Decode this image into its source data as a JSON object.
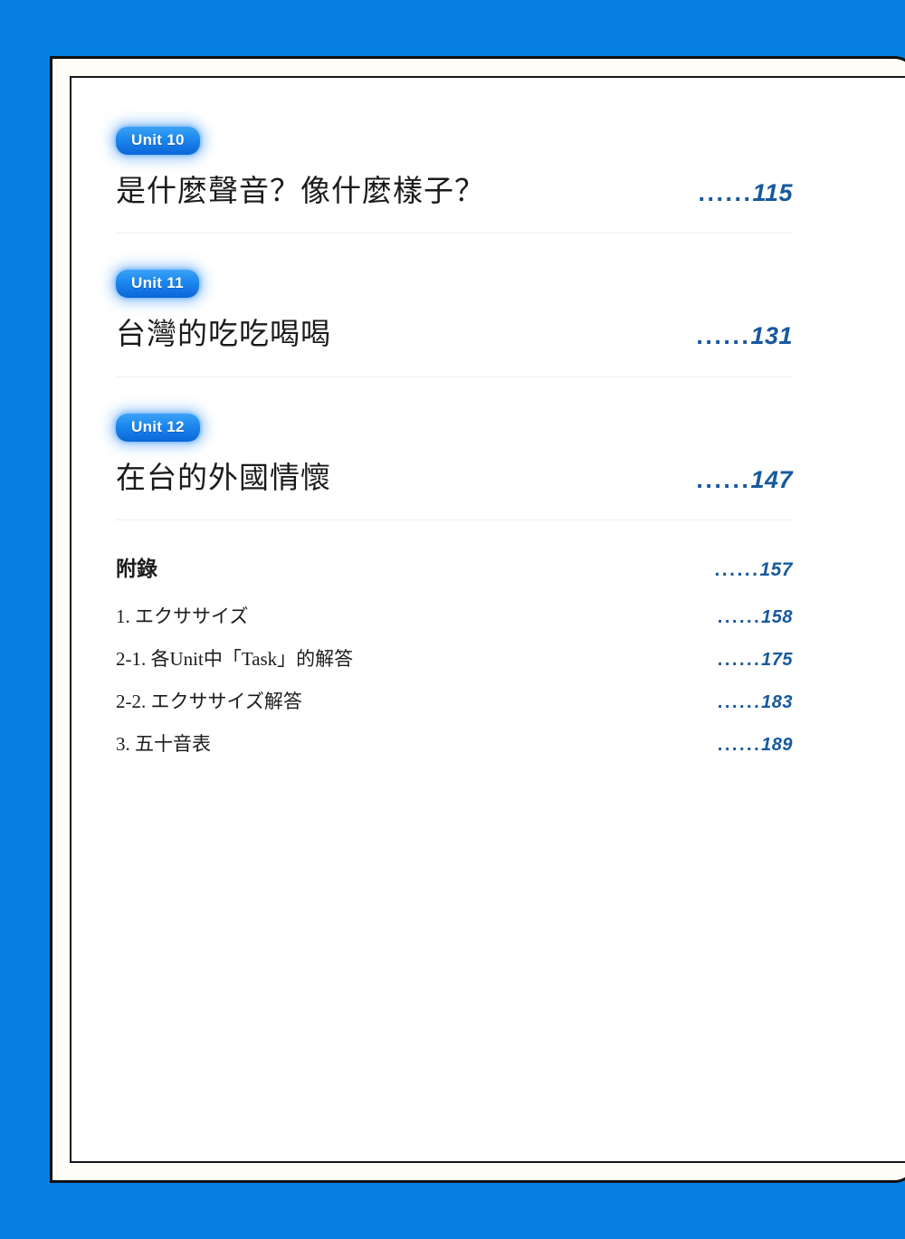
{
  "colors": {
    "background_blue": "#0580e2",
    "badge_blue": "#1f8bef",
    "page_number_blue": "#17599e",
    "paper": "#fffdf7",
    "frame_black": "#101010",
    "divider_gray": "#eeeeee"
  },
  "dots": "......",
  "units": [
    {
      "badge": "Unit 10",
      "title": "是什麼聲音？像什麼樣子？",
      "page": "115"
    },
    {
      "badge": "Unit 11",
      "title": "台灣的吃吃喝喝",
      "page": "131"
    },
    {
      "badge": "Unit 12",
      "title": "在台的外國情懷",
      "page": "147"
    }
  ],
  "appendix": {
    "heading": "附錄",
    "heading_page": "157",
    "items": [
      {
        "label": "1. エクササイズ",
        "page": "158"
      },
      {
        "label": "2-1. 各Unit中「Task」的解答",
        "page": "175"
      },
      {
        "label": "2-2. エクササイズ解答",
        "page": "183"
      },
      {
        "label": "3. 五十音表",
        "page": "189"
      }
    ]
  }
}
